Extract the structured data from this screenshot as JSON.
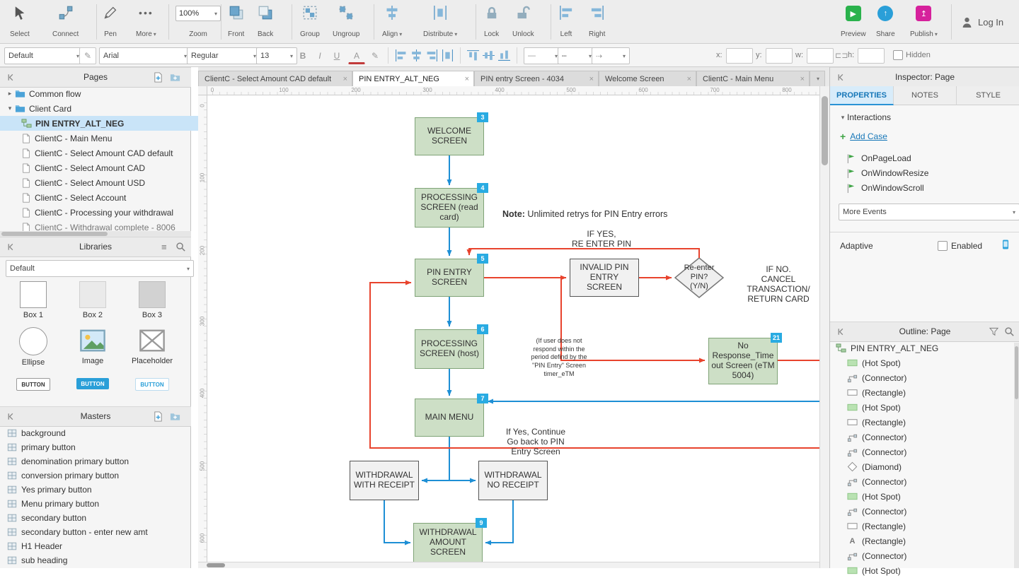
{
  "top_toolbar": {
    "select_label": "Select",
    "connect_label": "Connect",
    "pen_label": "Pen",
    "more_label": "More",
    "zoom_value": "100%",
    "zoom_label": "Zoom",
    "front_label": "Front",
    "back_label": "Back",
    "group_label": "Group",
    "ungroup_label": "Ungroup",
    "align_label": "Align",
    "distribute_label": "Distribute",
    "lock_label": "Lock",
    "unlock_label": "Unlock",
    "left_label": "Left",
    "right_label": "Right",
    "preview_label": "Preview",
    "share_label": "Share",
    "publish_label": "Publish",
    "login_label": "Log In"
  },
  "format_bar": {
    "style_preset": "Default",
    "font_family": "Arial",
    "font_weight": "Regular",
    "font_size": "13",
    "bold": "B",
    "italic": "I",
    "underline": "U",
    "color_letter": "A",
    "x_label": "x:",
    "y_label": "y:",
    "w_label": "w:",
    "h_label": "h:",
    "hidden_label": "Hidden"
  },
  "document_tabs": [
    {
      "label": "ClientC - Select Amount CAD default"
    },
    {
      "label": "PIN ENTRY_ALT_NEG"
    },
    {
      "label": "PIN entry Screen - 4034"
    },
    {
      "label": "Welcome Screen"
    },
    {
      "label": "ClientC - Main Menu"
    }
  ],
  "pages_panel": {
    "title": "Pages",
    "folders": [
      "Common flow",
      "Client Card"
    ],
    "items": [
      "PIN ENTRY_ALT_NEG",
      "ClientC - Main Menu",
      "ClientC - Select Amount CAD default",
      "ClientC - Select Amount CAD",
      "ClientC - Select Amount USD",
      "ClientC - Select Account",
      "ClientC - Processing your withdrawal",
      "ClientC - Withdrawal complete - 8006"
    ]
  },
  "libraries_panel": {
    "title": "Libraries",
    "selected_library": "Default",
    "items": [
      "Box 1",
      "Box 2",
      "Box 3",
      "Ellipse",
      "Image",
      "Placeholder",
      "BUTTON",
      "BUTTON",
      "BUTTON"
    ]
  },
  "masters_panel": {
    "title": "Masters",
    "items": [
      "background",
      "primary button",
      "denomination primary button",
      "conversion primary button",
      "Yes primary button",
      "Menu primary button",
      "secondary button",
      "secondary button - enter new amt",
      "H1 Header",
      "sub heading"
    ]
  },
  "canvas": {
    "ruler_h": [
      "0",
      "100",
      "200",
      "300",
      "400",
      "500",
      "600",
      "700",
      "800"
    ],
    "ruler_v": [
      "0",
      "100",
      "200",
      "300",
      "400",
      "500",
      "600"
    ],
    "nodes": {
      "welcome": {
        "label": "WELCOME SCREEN",
        "badge": "3"
      },
      "processing_read": {
        "label": "PROCESSING SCREEN (read card)",
        "badge": "4"
      },
      "pin_entry": {
        "label": "PIN ENTRY SCREEN",
        "badge": "5"
      },
      "processing_host": {
        "label": "PROCESSING SCREEN (host)",
        "badge": "6"
      },
      "main_menu": {
        "label": "MAIN MENU",
        "badge": "7"
      },
      "withdrawal_receipt": {
        "label": "WITHDRAWAL WITH RECEIPT"
      },
      "withdrawal_no_receipt": {
        "label": "WITHDRAWAL NO RECEIPT"
      },
      "withdrawal_amount": {
        "label": "WITHDRAWAL AMOUNT SCREEN",
        "badge": "9"
      },
      "invalid_pin": {
        "label": "INVALID PIN ENTRY SCREEN"
      },
      "reenter_diamond": {
        "label": "Re-enter\nPIN?\n(Y/N)"
      },
      "no_response": {
        "label": "No Response_Time out Screen (eTM 5004)",
        "badge": "21"
      }
    },
    "annotations": {
      "note_bold": "Note:",
      "note_rest": " Unlimited retrys for PIN Entry errors",
      "if_yes": "IF YES,\nRE ENTER PIN",
      "if_no": "IF NO.\nCANCEL\nTRANSACTION/\nRETURN CARD",
      "no_respond": "(If user does not respond within the period defind by the \"PIN Entry\" Screen timer_eTM",
      "if_yes_continue": "If Yes, Continue\nGo back to PIN\nEntry Screen"
    }
  },
  "inspector": {
    "title": "Inspector: Page",
    "tabs": [
      "PROPERTIES",
      "NOTES",
      "STYLE"
    ],
    "interactions_label": "Interactions",
    "add_case_label": "Add Case",
    "events": [
      "OnPageLoad",
      "OnWindowResize",
      "OnWindowScroll"
    ],
    "more_events_label": "More Events",
    "adaptive_label": "Adaptive",
    "enabled_label": "Enabled"
  },
  "outline": {
    "title": "Outline: Page",
    "items": [
      "PIN ENTRY_ALT_NEG",
      "(Hot Spot)",
      "(Connector)",
      "(Rectangle)",
      "(Hot Spot)",
      "(Rectangle)",
      "(Connector)",
      "(Connector)",
      "(Diamond)",
      "(Connector)",
      "(Hot Spot)",
      "(Connector)",
      "(Rectangle)",
      "(Rectangle)",
      "(Connector)",
      "(Hot Spot)"
    ]
  },
  "colors": {
    "accent_blue": "#29abe2",
    "flow_green": "#cddfc6",
    "connector_blue": "#1e8fd5",
    "connector_red": "#e8432d",
    "selection_blue": "#c9e4f8",
    "preview_green": "#2ab24c",
    "share_blue": "#2a9fd8",
    "publish_magenta": "#d6219c"
  }
}
